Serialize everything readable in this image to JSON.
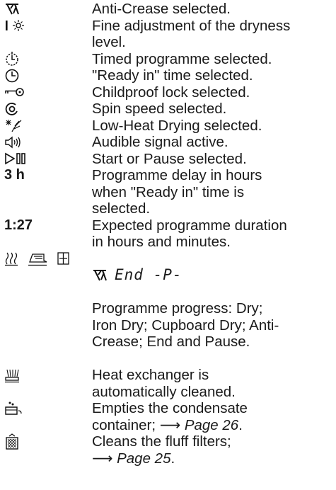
{
  "entries": [
    {
      "icon": "anti-crease-icon",
      "text": "Anti-Crease selected."
    },
    {
      "icon": "fine-adjustment-icon",
      "text": "Fine adjustment of the dryness\nlevel."
    },
    {
      "icon": "timed-programme-icon",
      "text": "Timed programme selected."
    },
    {
      "icon": "clock-icon",
      "text": "\"Ready in\" time selected."
    },
    {
      "icon": "key-lock-icon",
      "text": "Childproof lock selected."
    },
    {
      "icon": "spin-icon",
      "text": "Spin speed selected."
    },
    {
      "icon": "low-heat-icon",
      "text": "Low-Heat Drying selected."
    },
    {
      "icon": "speaker-icon",
      "text": "Audible signal active."
    },
    {
      "icon": "start-pause-icon",
      "text": "Start or Pause selected."
    },
    {
      "symbol_text": "3 h",
      "text": "Programme delay in hours\nwhen \"Ready in\" time is\nselected."
    },
    {
      "symbol_text": "1:27",
      "text": "Expected programme duration\nin hours and minutes."
    },
    {
      "icon": "progress-icons",
      "display": "End -P-",
      "text": "Programme progress: Dry;\nIron Dry; Cupboard Dry; Anti-\nCrease; End and Pause."
    },
    {
      "icon": "heat-exchanger-icon",
      "text": "Heat exchanger is\nautomatically cleaned."
    },
    {
      "icon": "condensate-container-icon",
      "text": "Empties the condensate\ncontainer; ",
      "link_arrow": "⟶",
      "link_text": "Page 26",
      "tail": "."
    },
    {
      "icon": "fluff-filter-icon",
      "text": "Cleans the fluff filters;\n",
      "link_arrow": "⟶",
      "link_text": "Page 25",
      "tail": "."
    }
  ]
}
